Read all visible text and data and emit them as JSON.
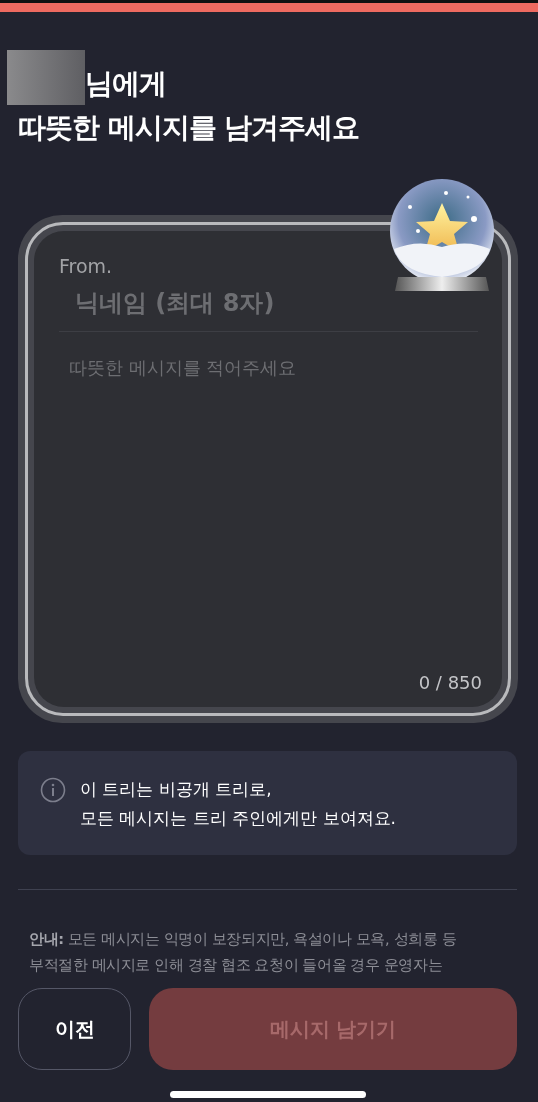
{
  "header": {
    "line_1": "님에게",
    "line_2": "따뜻한 메시지를 남겨주세요"
  },
  "card": {
    "from_label": "From.",
    "nickname": {
      "placeholder": "닉네임 (최대 8자)"
    },
    "message": {
      "placeholder": "따뜻한 메시지를 적어주세요"
    },
    "counter": "0 / 850"
  },
  "info": {
    "lines": [
      "이 트리는 비공개 트리로,",
      "모든 메시지는 트리 주인에게만 보여져요."
    ]
  },
  "notice": {
    "label": "안내:",
    "lines": [
      "모든 메시지는 익명이 보장되지만, 욕설이나 모욕, 성희롱 등",
      "부적절한 메시지로 인해 경찰 협조 요청이 들어올 경우 운영자는"
    ]
  },
  "buttons": [
    {
      "label": "이전",
      "kind": "secondary",
      "disabled": false
    },
    {
      "label": "메시지 남기기",
      "kind": "primary",
      "disabled": true
    }
  ]
}
